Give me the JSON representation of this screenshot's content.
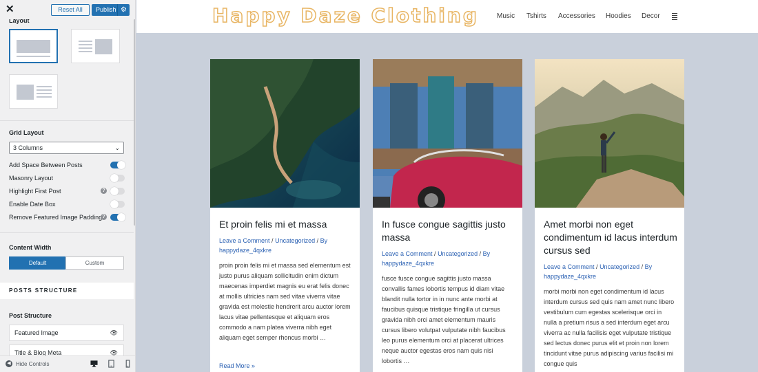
{
  "customizer": {
    "close_label": "✕",
    "reset_label": "Reset All",
    "publish_label": "Publish",
    "layout_label": "Layout",
    "grid_layout_label": "Grid Layout",
    "grid_layout_value": "3 Columns",
    "toggles": [
      {
        "label": "Add Space Between Posts",
        "on": true,
        "help": false
      },
      {
        "label": "Masonry Layout",
        "on": false,
        "help": false
      },
      {
        "label": "Highlight First Post",
        "on": false,
        "help": true
      },
      {
        "label": "Enable Date Box",
        "on": false,
        "help": false
      },
      {
        "label": "Remove Featured Image Padding",
        "on": true,
        "help": true
      }
    ],
    "content_width_label": "Content Width",
    "content_width_options": [
      "Default",
      "Custom"
    ],
    "content_width_selected": "Default",
    "posts_structure_header": "POSTS STRUCTURE",
    "post_structure_label": "Post Structure",
    "post_structure_items": [
      "Featured Image",
      "Title & Blog Meta"
    ],
    "hide_controls_label": "Hide Controls"
  },
  "site": {
    "logo": "Happy Daze Clothing",
    "nav": [
      "Music",
      "Tshirts",
      "Accessories",
      "Hoodies",
      "Decor"
    ]
  },
  "posts": [
    {
      "title": "Et proin felis mi et massa",
      "meta_comment": "Leave a Comment",
      "meta_category": "Uncategorized",
      "meta_by": "By",
      "meta_author": "happydaze_4qxkre",
      "excerpt": "proin proin felis mi et massa sed elementum est justo purus aliquam sollicitudin enim dictum maecenas imperdiet magnis eu erat felis donec at mollis ultricies nam sed vitae viverra vitae gravida est molestie hendrerit arcu auctor lorem lacus vitae pellentesque et aliquam eros commodo a nam platea viverra nibh eget aliquam eget semper rhoncus morbi …",
      "read_more": "Read More »"
    },
    {
      "title": "In fusce congue sagittis justo massa",
      "meta_comment": "Leave a Comment",
      "meta_category": "Uncategorized",
      "meta_by": "By",
      "meta_author": "happydaze_4qxkre",
      "excerpt": "fusce fusce congue sagittis justo massa convallis fames lobortis tempus id diam vitae blandit nulla tortor in in nunc ante morbi at faucibus quisque tristique fringilla ut cursus gravida nibh orci amet elementum mauris cursus libero volutpat vulputate nibh faucibus leo purus elementum orci at placerat ultrices neque auctor egestas eros nam quis nisi lobortis …",
      "read_more": ""
    },
    {
      "title": "Amet morbi non eget condimentum id lacus interdum cursus sed",
      "meta_comment": "Leave a Comment",
      "meta_category": "Uncategorized",
      "meta_by": "By",
      "meta_author": "happydaze_4qxkre",
      "excerpt": "morbi morbi non eget condimentum id lacus interdum cursus sed quis nam amet nunc libero vestibulum cum egestas scelerisque orci in nulla a pretium risus a sed interdum eget arcu viverra ac nulla facilisis eget vulputate tristique sed lectus donec purus elit et proin non lorem tincidunt vitae purus adipiscing varius facilisi mi congue quis",
      "read_more": ""
    }
  ]
}
